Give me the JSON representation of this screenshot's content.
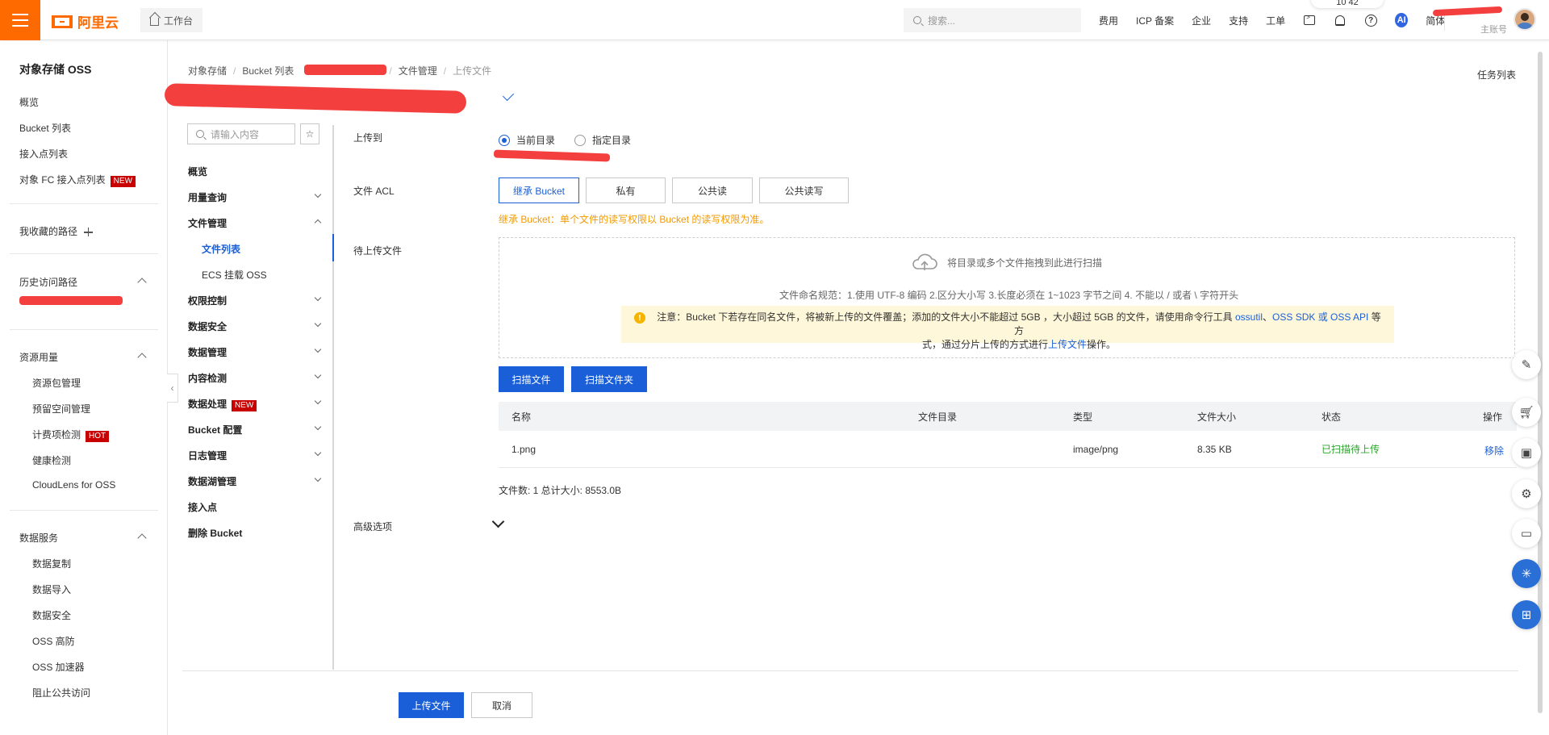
{
  "topbar": {
    "logo_text": "阿里云",
    "workbench": "工作台",
    "search_placeholder": "搜索...",
    "links": [
      "费用",
      "ICP 备案",
      "企业",
      "支持",
      "工单"
    ],
    "lang": "简体",
    "account_role": "主账号",
    "float_tag": "10 42",
    "ai_label": "AI"
  },
  "sidebar": {
    "title": "对象存储 OSS",
    "items": [
      "概览",
      "Bucket 列表",
      "接入点列表"
    ],
    "fc_item": "对象 FC 接入点列表",
    "new_tag": "NEW",
    "hot_tag": "HOT",
    "favorites": "我收藏的路径",
    "history": "历史访问路径",
    "resource_group": "资源用量",
    "resource_items": [
      "资源包管理",
      "预留空间管理",
      "计费项检测",
      "健康检测",
      "CloudLens for OSS"
    ],
    "data_group": "数据服务",
    "data_items": [
      "数据复制",
      "数据导入",
      "数据安全",
      "OSS 高防",
      "OSS 加速器",
      "阻止公共访问"
    ]
  },
  "nav2": {
    "search_placeholder": "请输入内容",
    "star": "☆",
    "items": [
      "概览",
      "用量查询",
      "文件管理",
      "权限控制",
      "数据安全",
      "数据管理",
      "内容检测",
      "数据处理",
      "Bucket 配置",
      "日志管理",
      "数据湖管理",
      "接入点",
      "删除 Bucket"
    ],
    "sub_items": [
      "文件列表",
      "ECS 挂载 OSS"
    ],
    "collapse": "‹"
  },
  "breadcrumb": [
    "对象存储",
    "Bucket 列表",
    "文件管理",
    "上传文件"
  ],
  "task_list": "任务列表",
  "form": {
    "upload_to_label": "上传到",
    "radio_current": "当前目录",
    "radio_specified": "指定目录",
    "acl_label": "文件 ACL",
    "acl_options": [
      "继承 Bucket",
      "私有",
      "公共读",
      "公共读写"
    ],
    "acl_hint": "继承 Bucket：单个文件的读写权限以 Bucket 的读写权限为准。",
    "pending_label": "待上传文件",
    "drop_hint": "将目录或多个文件拖拽到此进行扫描",
    "naming_rule": "文件命名规范：1.使用 UTF-8 编码 2.区分大小写 3.长度必须在 1~1023 字节之间 4. 不能以 / 或者 \\ 字符开头",
    "notice_line1_a": "注意：Bucket 下若存在同名文件，将被新上传的文件覆盖；添加的文件大小不能超过 5GB ，大小超过 5GB 的文件，请使用命令行工具 ",
    "notice_ossutil": "ossutil",
    "notice_sep": "、",
    "notice_sdk": "OSS SDK 或 OSS API",
    "notice_line1_b": " 等方",
    "notice_line2_a": "式，通过分片上传的方式进行",
    "notice_upload_link": "上传文件",
    "notice_line2_b": "操作。",
    "scan_files": "扫描文件",
    "scan_folder": "扫描文件夹",
    "advanced": "高级选项"
  },
  "table": {
    "headers": [
      "名称",
      "文件目录",
      "类型",
      "文件大小",
      "状态",
      "操作"
    ],
    "rows": [
      {
        "name": "1.png",
        "dir": "",
        "type": "image/png",
        "size": "8.35 KB",
        "status": "已扫描待上传",
        "action": "移除"
      }
    ],
    "summary": "文件数: 1   总计大小: 8553.0B"
  },
  "footer": {
    "upload": "上传文件",
    "cancel": "取消"
  },
  "colors": {
    "brand": "#ff6a00",
    "primary": "#1a5fd8",
    "warning": "#f29a00",
    "success": "#2ba52b",
    "new_tag": "#c80000"
  }
}
